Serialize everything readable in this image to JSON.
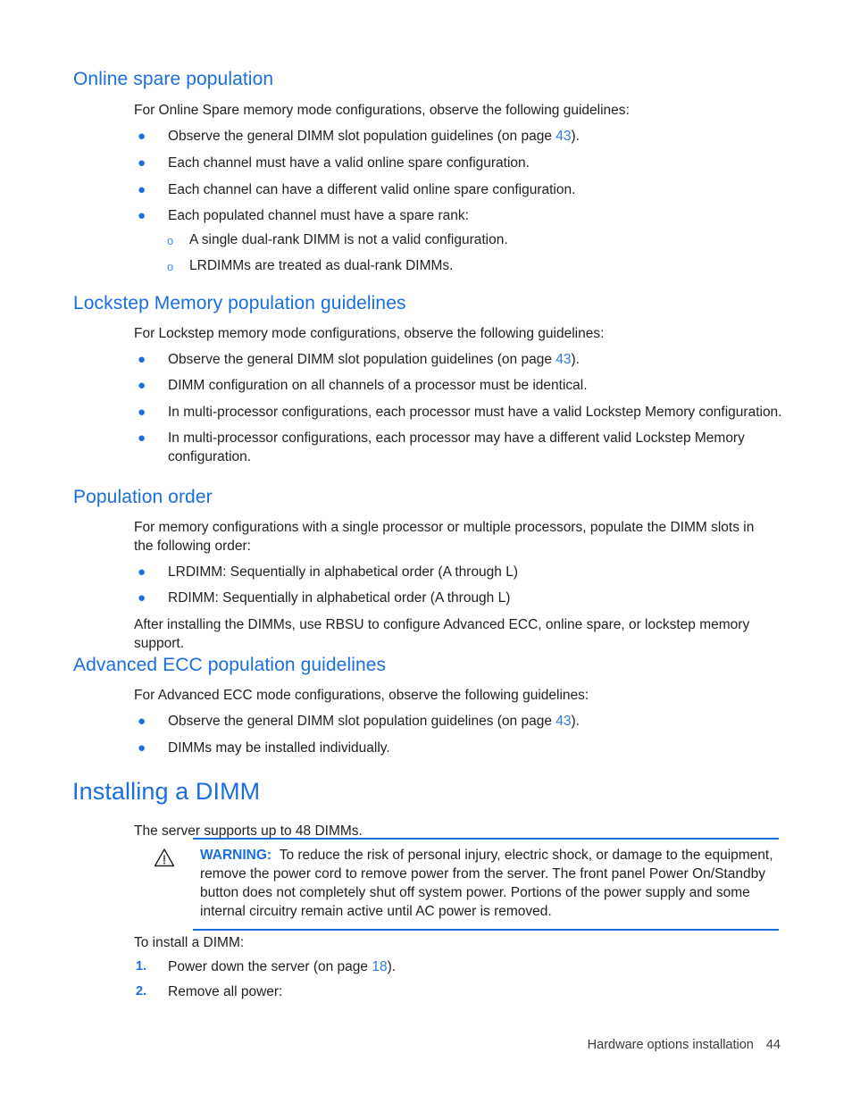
{
  "document": {
    "sections": [
      {
        "heading": "Online spare population",
        "intro": "For Online Spare memory mode configurations, observe the following guidelines:",
        "bullets": [
          {
            "text_before": "Observe the general DIMM slot population guidelines (on page ",
            "xref": "43",
            "text_after": ")."
          },
          {
            "text_before": "Each channel must have a valid online spare configuration.",
            "xref": "",
            "text_after": ""
          },
          {
            "text_before": "Each channel can have a different valid online spare configuration.",
            "xref": "",
            "text_after": ""
          },
          {
            "text_before": "Each populated channel must have a spare rank:",
            "xref": "",
            "text_after": ""
          }
        ],
        "subbullets": [
          "A single dual-rank DIMM is not a valid configuration.",
          "LRDIMMs are treated as dual-rank DIMMs."
        ]
      },
      {
        "heading": "Lockstep Memory population guidelines",
        "intro": "For Lockstep memory mode configurations, observe the following guidelines:",
        "bullets": [
          {
            "text_before": "Observe the general DIMM slot population guidelines (on page ",
            "xref": "43",
            "text_after": ")."
          },
          {
            "text_before": "DIMM configuration on all channels of a processor must be identical.",
            "xref": "",
            "text_after": ""
          },
          {
            "text_before": "In multi-processor configurations, each processor must have a valid Lockstep Memory configuration.",
            "xref": "",
            "text_after": ""
          },
          {
            "text_before": "In multi-processor configurations, each processor may have a different valid Lockstep Memory configuration.",
            "xref": "",
            "text_after": ""
          }
        ]
      },
      {
        "heading": "Population order",
        "intro": "For memory configurations with a single processor or multiple processors, populate the DIMM slots in the following order:",
        "bullets": [
          {
            "text_before": "LRDIMM: Sequentially in alphabetical order (A through L)",
            "xref": "",
            "text_after": ""
          },
          {
            "text_before": "RDIMM: Sequentially in alphabetical order (A through L)",
            "xref": "",
            "text_after": ""
          }
        ],
        "closing": "After installing the DIMMs, use RBSU to configure Advanced ECC, online spare, or lockstep memory support."
      },
      {
        "heading": "Advanced ECC population guidelines",
        "intro": "For Advanced ECC mode configurations, observe the following guidelines:",
        "bullets": [
          {
            "text_before": "Observe the general DIMM slot population guidelines (on page ",
            "xref": "43",
            "text_after": ")."
          },
          {
            "text_before": "DIMMs may be installed individually.",
            "xref": "",
            "text_after": ""
          }
        ]
      }
    ],
    "chapter": {
      "heading": "Installing a DIMM",
      "intro": "The server supports up to 48 DIMMs.",
      "warning": {
        "icon_name": "warning-triangle-icon",
        "label": "WARNING:",
        "text": "To reduce the risk of personal injury, electric shock, or damage to the equipment, remove the power cord to remove power from the server. The front panel Power On/Standby button does not completely shut off system power. Portions of the power supply and some internal circuitry remain active until AC power is removed."
      },
      "steps_intro": "To install a DIMM:",
      "steps": [
        {
          "num": "1.",
          "text_before": "Power down the server (on page ",
          "xref": "18",
          "text_after": ")."
        },
        {
          "num": "2.",
          "text_before": "Remove all power:",
          "xref": "",
          "text_after": ""
        }
      ]
    },
    "footer": {
      "title": "Hardware options installation",
      "page": "44"
    },
    "colors": {
      "heading_blue": "#1a6ee0",
      "link_blue": "#2b7de0",
      "body_black": "#231f20",
      "rule_blue": "#1a6ee0"
    }
  }
}
